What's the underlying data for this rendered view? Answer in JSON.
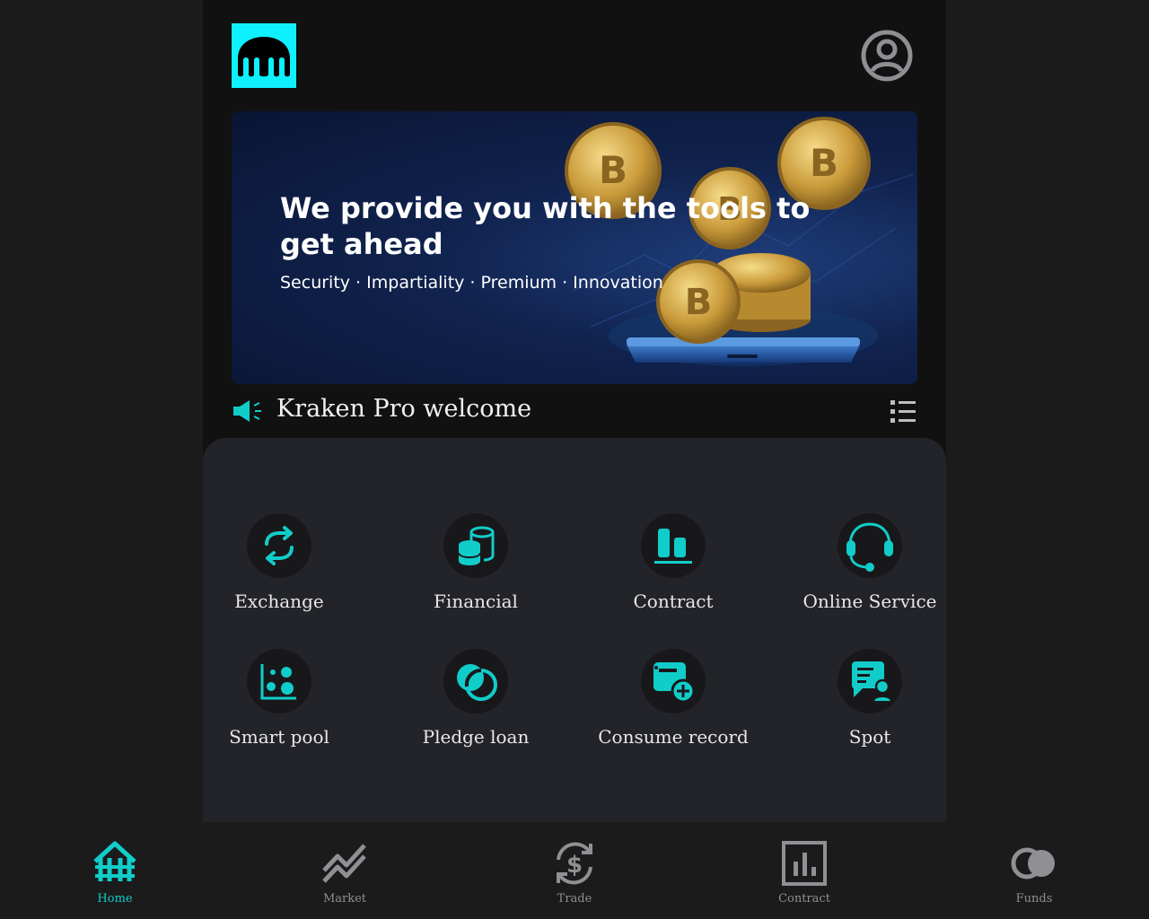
{
  "colors": {
    "accent": "#11cdc9",
    "logo_bg": "#0ff0ff",
    "inactive": "#8f8f94",
    "panel": "#232429"
  },
  "banner": {
    "title": "We provide you with the tools to get ahead",
    "subtitle": "Security · Impartiality · Premium · Innovation"
  },
  "notice": {
    "text": "Kraken Pro welcome"
  },
  "grid": {
    "items": [
      {
        "label": "Exchange",
        "icon": "exchange-icon"
      },
      {
        "label": "Financial",
        "icon": "coins-stack-icon"
      },
      {
        "label": "Contract",
        "icon": "bar-chart-icon"
      },
      {
        "label": "Online Service",
        "icon": "headset-icon"
      },
      {
        "label": "Smart pool",
        "icon": "scatter-chart-icon"
      },
      {
        "label": "Pledge loan",
        "icon": "overlap-circles-icon"
      },
      {
        "label": "Consume record",
        "icon": "card-plus-icon"
      },
      {
        "label": "Spot",
        "icon": "chat-user-icon"
      }
    ]
  },
  "tabbar": {
    "items": [
      {
        "label": "Home",
        "icon": "home-icon",
        "active": true
      },
      {
        "label": "Market",
        "icon": "market-trend-icon",
        "active": false
      },
      {
        "label": "Trade",
        "icon": "dollar-swap-icon",
        "active": false
      },
      {
        "label": "Contract",
        "icon": "chart-board-icon",
        "active": false
      },
      {
        "label": "Funds",
        "icon": "funds-circles-icon",
        "active": false
      }
    ]
  }
}
